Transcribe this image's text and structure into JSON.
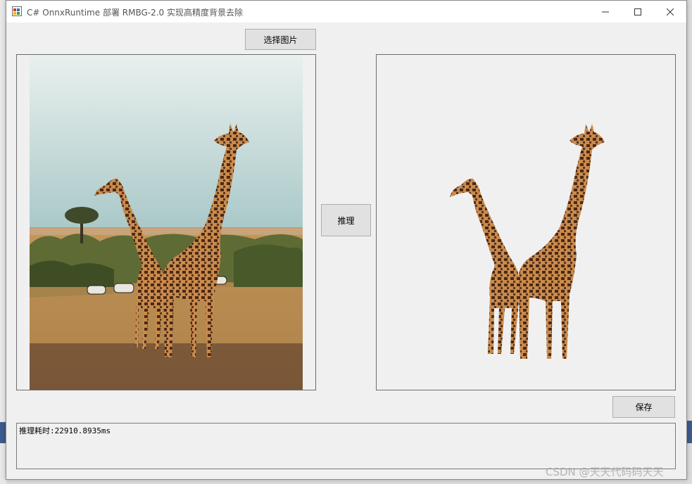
{
  "window": {
    "title": "C# OnnxRuntime 部署 RMBG-2.0 实现高精度背景去除"
  },
  "buttons": {
    "select_image": "选择图片",
    "inference": "推理",
    "save": "保存"
  },
  "output": {
    "text": "推理耗时:22910.8935ms"
  },
  "watermark": {
    "text": "CSDN @天天代码码天天"
  },
  "icons": {
    "app": "winforms-app-icon",
    "minimize": "minimize-icon",
    "maximize": "maximize-icon",
    "close": "close-icon"
  },
  "colors": {
    "window_bg": "#f0f0f0",
    "button_bg": "#e1e1e1",
    "sky": "#cfe0df",
    "savanna": "#b48a4c"
  }
}
